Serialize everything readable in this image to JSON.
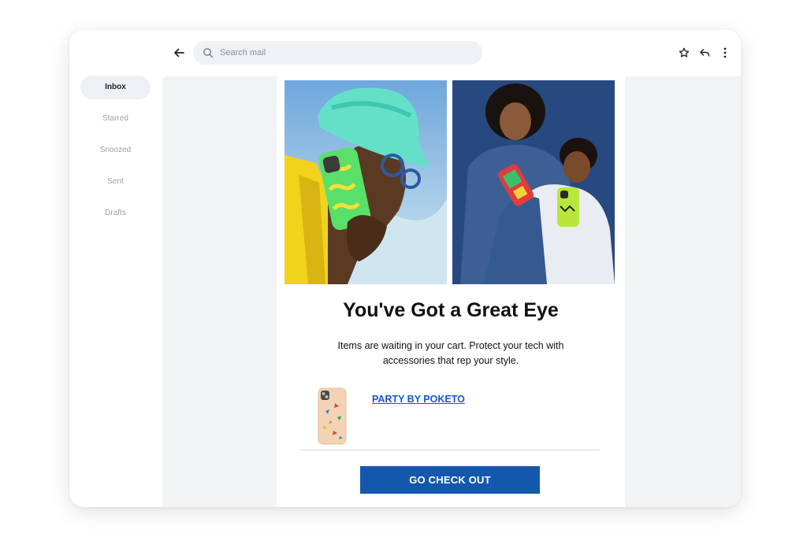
{
  "search": {
    "placeholder": "Search mail"
  },
  "sidebar": {
    "items": [
      {
        "label": "Inbox",
        "active": true
      },
      {
        "label": "Starred"
      },
      {
        "label": "Snoozed"
      },
      {
        "label": "Sent"
      },
      {
        "label": "Drafts"
      }
    ]
  },
  "toolbar": {
    "icons": [
      "back-arrow-icon",
      "star-icon",
      "reply-icon",
      "more-vertical-icon"
    ]
  },
  "email": {
    "headline": "You've Got a Great Eye",
    "body_line1": "Items are waiting in your cart. Protect your tech with",
    "body_line2": "accessories that rep your style.",
    "product_name": "PARTY BY POKETO",
    "cta_label": "GO CHECK OUT"
  },
  "colors": {
    "cta": "#1458ad",
    "link": "#1557d1",
    "content_bg": "#f1f3f5"
  }
}
